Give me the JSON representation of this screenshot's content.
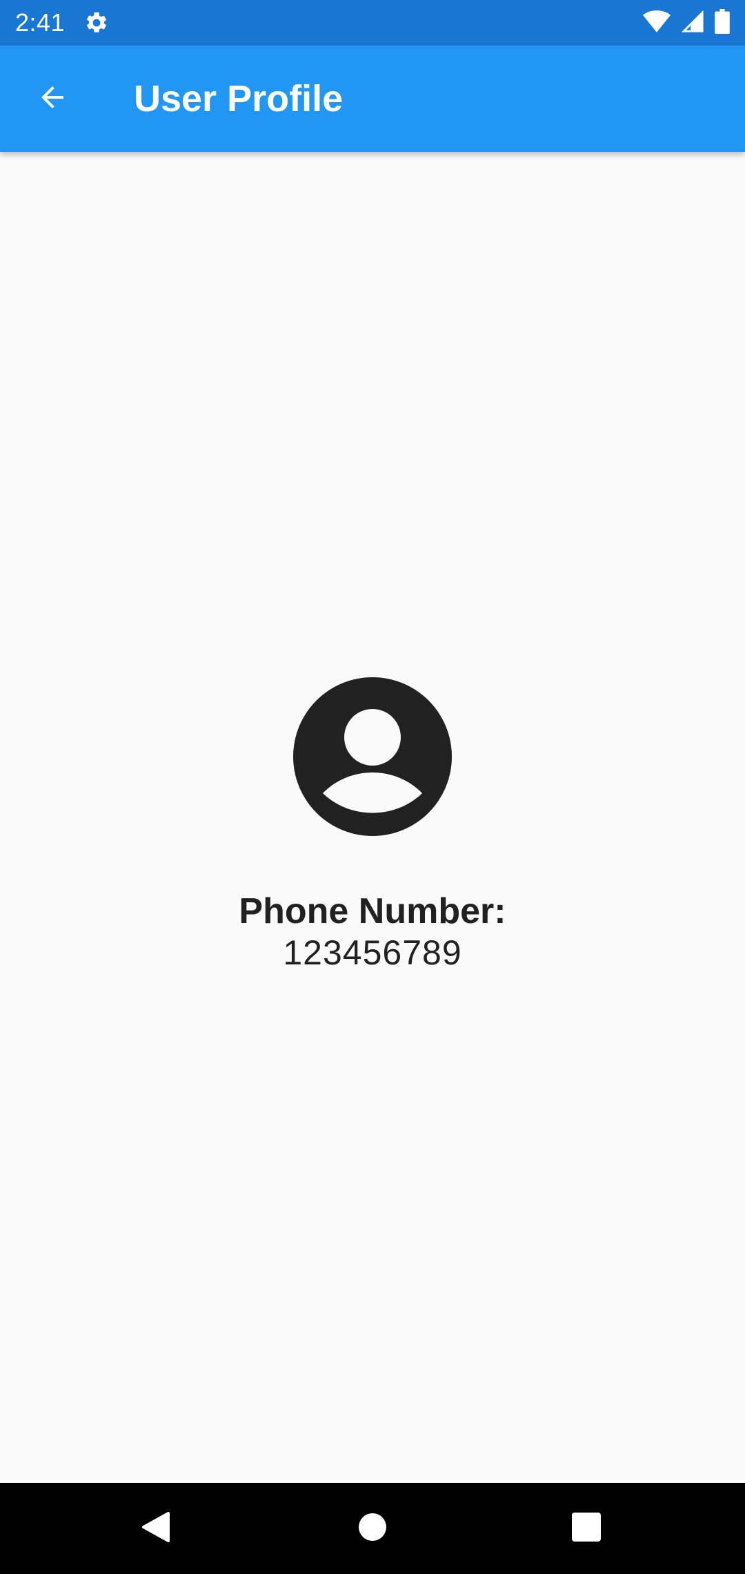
{
  "status_bar": {
    "time": "2:41",
    "icons": [
      "gear-icon",
      "wifi-icon",
      "signal-icon",
      "battery-icon"
    ],
    "background": "#1976d2"
  },
  "app_bar": {
    "title": "User Profile",
    "back_icon": "arrow-back-icon",
    "background": "#2196f3"
  },
  "profile": {
    "avatar_icon": "account-circle-icon",
    "phone_label": "Phone Number:",
    "phone_value": "123456789"
  },
  "navigation_bar": {
    "buttons": [
      "back-triangle-icon",
      "home-circle-icon",
      "recents-square-icon"
    ]
  }
}
